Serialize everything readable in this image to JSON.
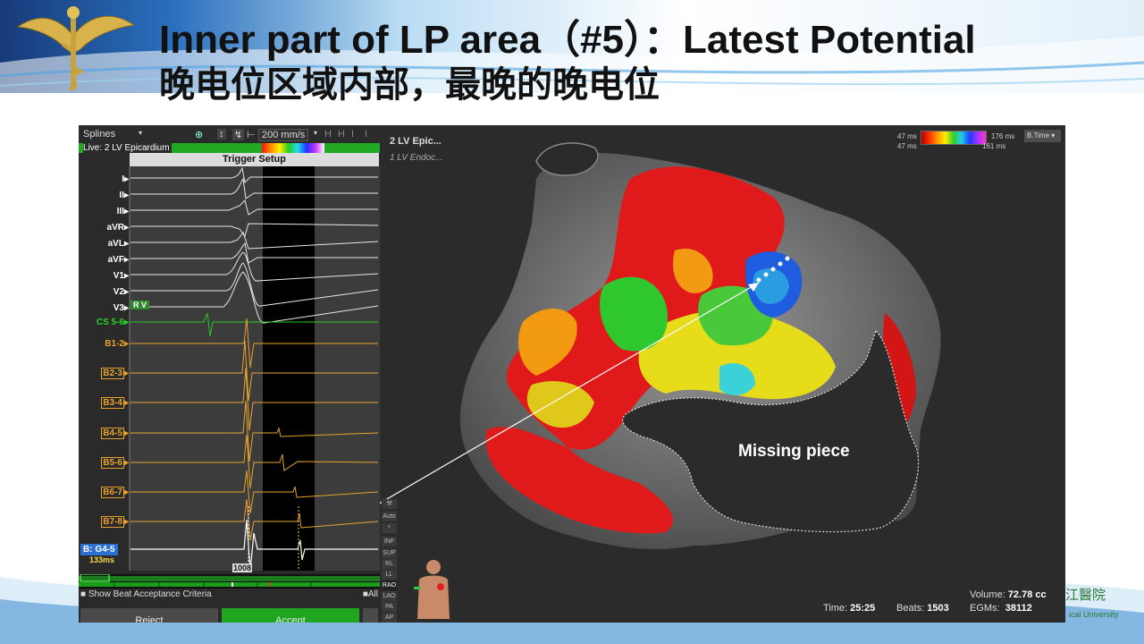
{
  "slide": {
    "title_en": "Inner part of LP area（#5）：Latest Potential",
    "title_cn": "晚电位区域内部，最晚的晚电位",
    "logo_right_text": "江醫院",
    "logo_right_sub": "ical University"
  },
  "left_panel": {
    "toolbar": {
      "splines_label": "Splines",
      "speed_label": "200 mm/s"
    },
    "live_label": "Live: 2 LV Epicardium",
    "trigger_title": "Trigger Setup",
    "leads": [
      {
        "label": "I",
        "color": "white",
        "boxed": false
      },
      {
        "label": "II",
        "color": "white",
        "boxed": false
      },
      {
        "label": "III",
        "color": "white",
        "boxed": false
      },
      {
        "label": "aVR",
        "color": "white",
        "boxed": false
      },
      {
        "label": "aVL",
        "color": "white",
        "boxed": false
      },
      {
        "label": "aVF",
        "color": "white",
        "boxed": false
      },
      {
        "label": "V1",
        "color": "white",
        "boxed": false
      },
      {
        "label": "V2",
        "color": "white",
        "boxed": false
      },
      {
        "label": "V3",
        "color": "white",
        "boxed": false
      },
      {
        "label": "CS 5-6",
        "color": "green",
        "boxed": false
      },
      {
        "label": "B1-2",
        "color": "orange",
        "boxed": false
      },
      {
        "label": "B2-3",
        "color": "orange",
        "boxed": true
      },
      {
        "label": "B3-4",
        "color": "orange",
        "boxed": true
      },
      {
        "label": "B4-5",
        "color": "orange",
        "boxed": true
      },
      {
        "label": "B5-6",
        "color": "orange",
        "boxed": true
      },
      {
        "label": "B6-7",
        "color": "orange",
        "boxed": true
      },
      {
        "label": "B7-8",
        "color": "orange",
        "boxed": true
      }
    ],
    "rv_tag": "R V",
    "active_lead": "B: G4-5",
    "active_ms": "133ms",
    "marker_label": "1008",
    "show_beat": "Show Beat Acceptance Criteria",
    "all_label": "All",
    "reject_label": "Reject",
    "accept_label": "Accept"
  },
  "map_panel": {
    "map_name_1": "2 LV Epic...",
    "map_name_2": "1 LV Endoc...",
    "scale_min_top": "47 ms",
    "scale_min_bottom": "47 ms",
    "scale_max_top": "176 ms",
    "scale_max_bottom": "161 ms",
    "mode_dropdown": "B.Time",
    "annotation": "Missing piece",
    "side_buttons": [
      "Auto",
      "*",
      "INF",
      "SUP",
      "RL",
      "LL",
      "RAO",
      "LAO",
      "PA",
      "AP"
    ],
    "stats": {
      "time_label": "Time:",
      "time_value": "25:25",
      "beats_label": "Beats:",
      "beats_value": "1503",
      "volume_label": "Volume:",
      "volume_value": "72.78 cc",
      "egms_label": "EGMs:",
      "egms_value": "38112"
    }
  }
}
